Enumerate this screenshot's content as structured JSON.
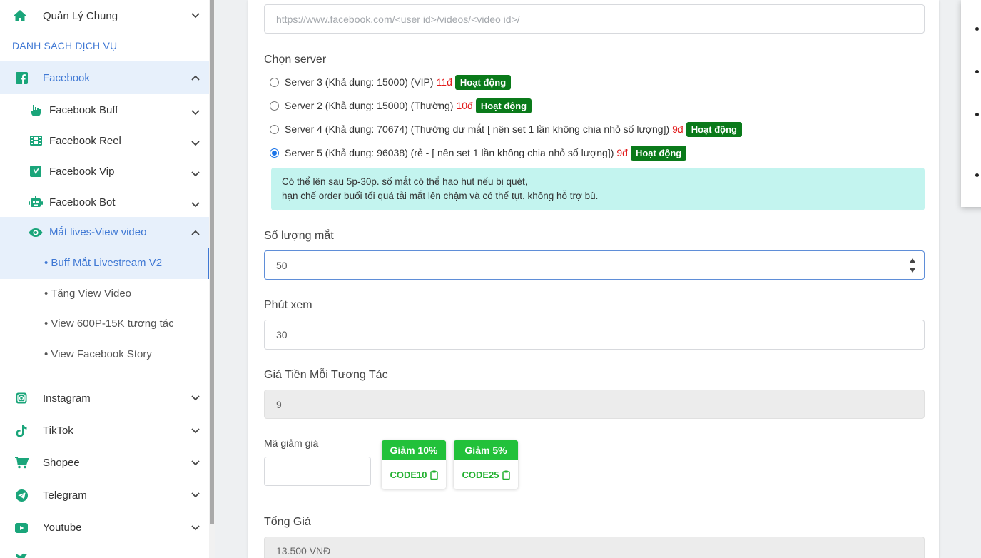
{
  "sidebar": {
    "top_item": {
      "label": "Quản Lý Chung",
      "icon": "home-icon"
    },
    "section_title": "DANH SÁCH DỊCH VỤ",
    "facebook": {
      "label": "Facebook",
      "icon": "facebook-square-icon"
    },
    "facebook_children": [
      {
        "label": "Facebook Buff",
        "icon": "hand-icon"
      },
      {
        "label": "Facebook Reel",
        "icon": "film-icon"
      },
      {
        "label": "Facebook Vip",
        "icon": "vimeo-square-icon"
      },
      {
        "label": "Facebook Bot",
        "icon": "robot-icon"
      },
      {
        "label": "Mắt lives-View video",
        "icon": "eye-icon"
      }
    ],
    "livestream_children": [
      "Buff Mắt Livestream V2",
      "Tăng View Video",
      "View 600P-15K tương tác",
      "View Facebook Story"
    ],
    "other_items": [
      {
        "label": "Instagram",
        "icon": "instagram-icon"
      },
      {
        "label": "TikTok",
        "icon": "tiktok-icon"
      },
      {
        "label": "Shopee",
        "icon": "cart-icon"
      },
      {
        "label": "Telegram",
        "icon": "telegram-icon"
      },
      {
        "label": "Youtube",
        "icon": "youtube-icon"
      }
    ]
  },
  "form": {
    "link_placeholder": "https://www.facebook.com/<user id>/videos/<video id>/",
    "server_label": "Chọn server",
    "servers": [
      {
        "text": "Server 3 (Khả dụng: 15000) (VIP)",
        "price": "11đ",
        "status": "Hoạt động",
        "checked": false
      },
      {
        "text": "Server 2 (Khả dụng: 15000) (Thường)",
        "price": "10đ",
        "status": "Hoạt động",
        "checked": false
      },
      {
        "text": "Server 4 (Khả dụng: 70674) (Thường dư mắt [ nên set 1 lần không chia nhỏ số lượng])",
        "price": "9đ",
        "status": "Hoạt động",
        "checked": false
      },
      {
        "text": "Server 5 (Khả dụng: 96038) (rẻ - [ nên set 1 lần không chia nhỏ số lượng])",
        "price": "9đ",
        "status": "Hoạt động",
        "checked": true
      }
    ],
    "note_line1": "Có thể lên sau 5p-30p. số mắt có thể hao hụt nếu bị quét,",
    "note_line2": "hạn chế order buổi tối quá tải mắt lên chậm và có thể tụt. không hỗ trợ bù.",
    "quantity_label": "Số lượng mắt",
    "quantity_value": "50",
    "minutes_label": "Phút xem",
    "minutes_value": "30",
    "unit_price_label": "Giá Tiền Mỗi Tương Tác",
    "unit_price_value": "9",
    "discount_label": "Mã giảm giá",
    "discount_value": "",
    "coupons": [
      {
        "title": "Giảm 10%",
        "code": "CODE10"
      },
      {
        "title": "Giảm 5%",
        "code": "CODE25"
      }
    ],
    "total_label": "Tổng Giá",
    "total_value": "13.500 VNĐ"
  },
  "colors": {
    "accent": "#3f78d4",
    "icon_teal": "#1aa57a",
    "badge_green": "#0a7a1a",
    "price_red": "#e21b1b",
    "coupon_green": "#22c13a"
  }
}
